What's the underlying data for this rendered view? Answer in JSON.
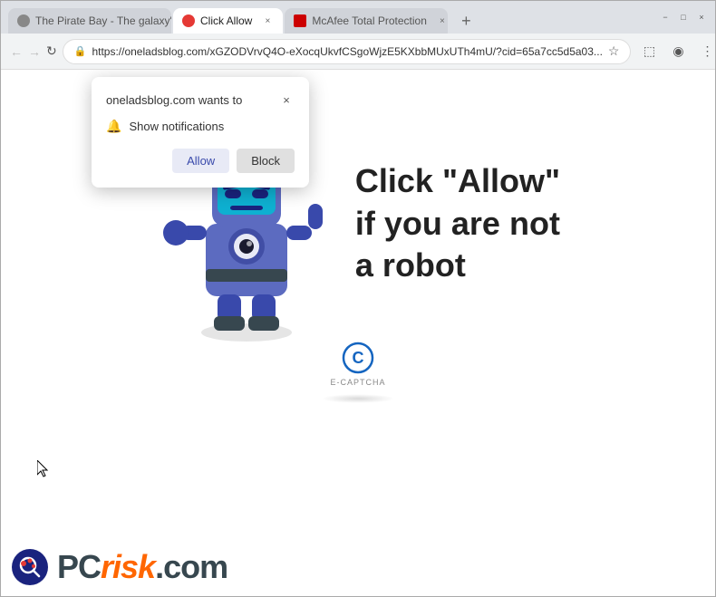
{
  "browser": {
    "tabs": [
      {
        "id": "pirate",
        "label": "The Pirate Bay - The galaxy's m...",
        "active": false,
        "favicon": "pirate"
      },
      {
        "id": "clickallow",
        "label": "Click Allow",
        "active": true,
        "favicon": "clickallow"
      },
      {
        "id": "mcafee",
        "label": "McAfee Total Protection",
        "active": false,
        "favicon": "mcafee"
      }
    ],
    "new_tab_label": "+",
    "window_controls": [
      "−",
      "□",
      "×"
    ]
  },
  "navbar": {
    "back_tooltip": "Back",
    "forward_tooltip": "Forward",
    "reload_tooltip": "Reload",
    "url": "https://oneladsblog.com/xGZODVrvQ4O-eXocqUkvfCSgoWjzE5KXbbMUxUTh4mU/?cid=65a7cc5d5a03...",
    "url_short": "https://oneladsblog.com/xGZODVrvQ4O-eXocqUkvfCSgoWjzE5KXbbMUxUTh4mU/?cid=65a7cc5d5a03...",
    "star_icon": "☆",
    "extension_icon": "⬚",
    "profile_icon": "◉",
    "menu_icon": "⋮"
  },
  "notification_popup": {
    "title": "oneladsblog.com wants to",
    "close_label": "×",
    "notification_text": "Show notifications",
    "bell_icon": "🔔",
    "allow_label": "Allow",
    "block_label": "Block"
  },
  "page": {
    "click_allow_line1": "Click \"Allow\"",
    "click_allow_line2": "if you are not",
    "click_allow_line3": "a robot",
    "captcha_label": "E-CAPTCHA"
  },
  "pcrisk": {
    "logo_text": "PC",
    "logo_suffix": "risk.com"
  }
}
